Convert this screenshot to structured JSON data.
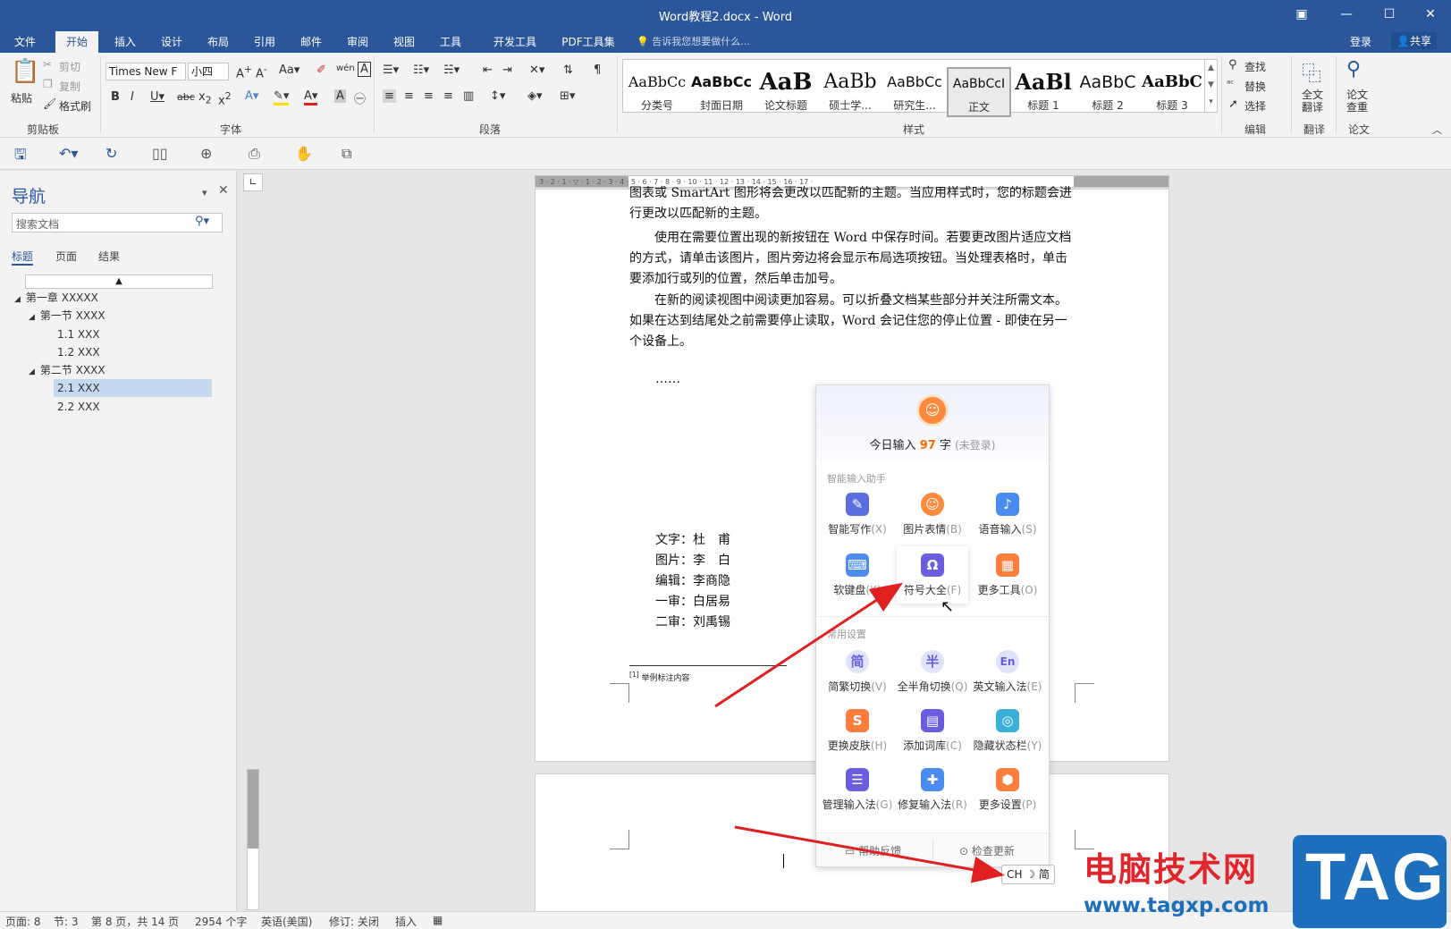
{
  "window": {
    "title": "Word教程2.docx - Word",
    "controls": [
      "▣",
      "—",
      "☐",
      "✕"
    ]
  },
  "menu": {
    "tabs": [
      "文件",
      "开始",
      "插入",
      "设计",
      "布局",
      "引用",
      "邮件",
      "审阅",
      "视图",
      "工具",
      "开发工具",
      "PDF工具集"
    ],
    "active": "开始",
    "tell_me": "告诉我您想要做什么...",
    "login": "登录",
    "share": "共享"
  },
  "ribbon": {
    "clipboard": {
      "label": "剪贴板",
      "paste": "粘贴",
      "cut": "剪切",
      "copy": "复制",
      "format_painter": "格式刷"
    },
    "font": {
      "label": "字体",
      "font_name": "Times New F",
      "font_size": "小四"
    },
    "paragraph": {
      "label": "段落"
    },
    "styles": {
      "label": "样式",
      "items": [
        {
          "preview": "AaBbCc",
          "name": "分类号"
        },
        {
          "preview": "AaBbCc",
          "name": "封面日期"
        },
        {
          "preview": "AaB",
          "name": "论文标题"
        },
        {
          "preview": "AaBb",
          "name": "硕士学..."
        },
        {
          "preview": "AaBbCc",
          "name": "研究生..."
        },
        {
          "preview": "AaBbCcI",
          "name": "正文"
        },
        {
          "preview": "AaBl",
          "name": "标题 1"
        },
        {
          "preview": "AaBbC",
          "name": "标题 2"
        },
        {
          "preview": "AaBbC",
          "name": "标题 3"
        }
      ]
    },
    "editing": {
      "label": "编辑",
      "find": "查找",
      "replace": "替换",
      "select": "选择"
    },
    "translate": {
      "label": "翻译",
      "full": "全文翻译"
    },
    "paper": {
      "label": "论文",
      "check": "论文查重"
    }
  },
  "nav": {
    "title": "导航",
    "search_placeholder": "搜索文档",
    "tabs": [
      "标题",
      "页面",
      "结果"
    ],
    "tree": [
      {
        "label": "第一章 XXXXX",
        "level": 0,
        "expanded": true
      },
      {
        "label": "第一节 XXXX",
        "level": 1,
        "expanded": true
      },
      {
        "label": "1.1 XXX",
        "level": 2
      },
      {
        "label": "1.2 XXX",
        "level": 2
      },
      {
        "label": "第二节 XXXX",
        "level": 1,
        "expanded": true
      },
      {
        "label": "2.1 XXX",
        "level": 2,
        "selected": true
      },
      {
        "label": "2.2 XXX",
        "level": 2
      }
    ]
  },
  "ruler": {
    "marks": "3 · 2 · 1 · ▽ · 1 · 2 · 3 · 4 · 5 · 6 · 7 · 8 · 9 · 10 · 11 · 12 · 13 · 14 · 15 · 16 · 17 ·"
  },
  "document": {
    "paragraphs": [
      "图表或 SmartArt 图形将会更改以匹配新的主题。当应用样式时，您的标题会进行更改以匹配新的主题。",
      "使用在需要位置出现的新按钮在 Word 中保存时间。若要更改图片适应文档的方式，请单击该图片，图片旁边将会显示布局选项按钮。当处理表格时，单击要添加行或列的位置，然后单击加号。",
      "在新的阅读视图中阅读更加容易。可以折叠文档某些部分并关注所需文本。如果在达到结尾处之前需要停止读取，Word 会记住您的停止位置 - 即使在另一个设备上。"
    ],
    "ellipsis": "……",
    "credits": [
      {
        "role": "文字：",
        "name": "杜　甫"
      },
      {
        "role": "图片：",
        "name": "李　白"
      },
      {
        "role": "编辑：",
        "name": "李商隐"
      },
      {
        "role": "一审：",
        "name": "白居易"
      },
      {
        "role": "二审：",
        "name": "刘禹锡"
      }
    ],
    "footnote": "举例标注内容"
  },
  "ime_panel": {
    "today_prefix": "今日输入",
    "today_count": "97",
    "today_suffix": "字",
    "status": "(未登录)",
    "section_assist": "智能输入助手",
    "section_settings": "常用设置",
    "assist_items": [
      {
        "label": "智能写作",
        "key": "(X)",
        "color": "#5a6ee0",
        "glyph": "✎"
      },
      {
        "label": "图片表情",
        "key": "(B)",
        "color": "#ff8a3d",
        "glyph": "☺"
      },
      {
        "label": "语音输入",
        "key": "(S)",
        "color": "#4b8cf0",
        "glyph": "♪"
      },
      {
        "label": "软键盘",
        "key": "(K)",
        "color": "#4b8cf0",
        "glyph": "⌨"
      },
      {
        "label": "符号大全",
        "key": "(F)",
        "color": "#6a5de0",
        "glyph": "Ω"
      },
      {
        "label": "更多工具",
        "key": "(O)",
        "color": "#ff7d3d",
        "glyph": "▦"
      }
    ],
    "setting_items": [
      {
        "label": "简繁切换",
        "key": "(V)",
        "color": "#dfe4fb",
        "glyph": "简"
      },
      {
        "label": "全半角切换",
        "key": "(Q)",
        "color": "#dfe4fb",
        "glyph": "半"
      },
      {
        "label": "英文输入法",
        "key": "(E)",
        "color": "#dfe4fb",
        "glyph": "En"
      },
      {
        "label": "更换皮肤",
        "key": "(H)",
        "color": "#ff7d3d",
        "glyph": "S"
      },
      {
        "label": "添加词库",
        "key": "(C)",
        "color": "#6a5de0",
        "glyph": "▤"
      },
      {
        "label": "隐藏状态栏",
        "key": "(Y)",
        "color": "#3ab0d8",
        "glyph": "◎"
      },
      {
        "label": "管理输入法",
        "key": "(G)",
        "color": "#6a5de0",
        "glyph": "☰"
      },
      {
        "label": "修复输入法",
        "key": "(R)",
        "color": "#4b8cf0",
        "glyph": "✚"
      },
      {
        "label": "更多设置",
        "key": "(P)",
        "color": "#ff7d3d",
        "glyph": "⬢"
      }
    ],
    "footer": {
      "feedback": "帮助反馈",
      "update": "检查更新"
    }
  },
  "ime_tray": "CH ☽ 简",
  "statusbar": {
    "page": "页面: 8",
    "section": "节: 3",
    "page_of": "第 8 页，共 14 页",
    "words": "2954 个字",
    "language": "英语(美国)",
    "track": "修订: 关闭",
    "mode": "插入"
  },
  "watermark": {
    "text": "电脑技术网",
    "url": "www.tagxp.com",
    "logo": "TAG"
  },
  "colors": {
    "accent": "#2b579a",
    "annotation_arrow": "#e02020"
  }
}
